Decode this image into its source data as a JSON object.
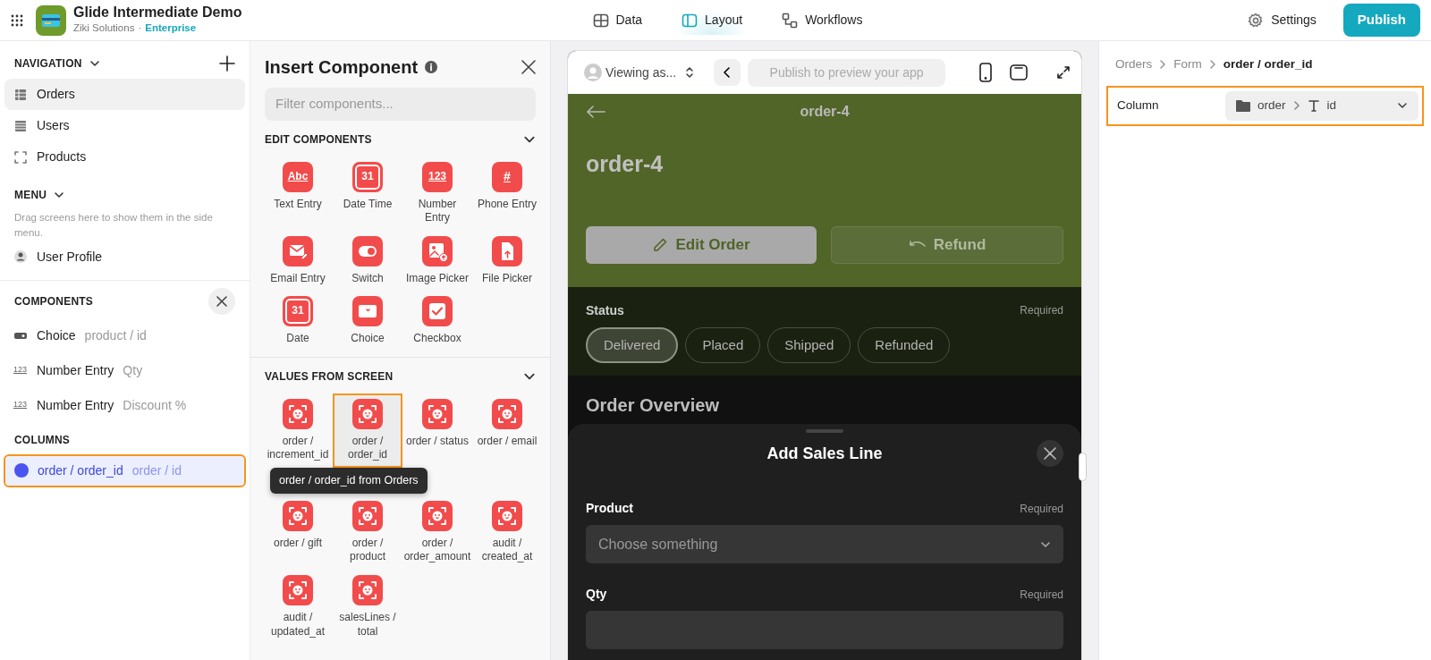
{
  "app": {
    "title": "Glide Intermediate Demo",
    "org": "Ziki Solutions",
    "separator": "·",
    "plan": "Enterprise"
  },
  "top_tabs": [
    {
      "label": "Data",
      "kind": "data",
      "selected": false
    },
    {
      "label": "Layout",
      "kind": "layout",
      "selected": true
    },
    {
      "label": "Workflows",
      "kind": "workflows",
      "selected": false
    }
  ],
  "settings_label": "Settings",
  "publish_button": "Publish",
  "sidebar": {
    "navigation_heading": "NAVIGATION",
    "nav_items": [
      {
        "label": "Orders",
        "kind": "grid",
        "selected": true
      },
      {
        "label": "Users",
        "kind": "list",
        "selected": false
      },
      {
        "label": "Products",
        "kind": "frame",
        "selected": false
      }
    ],
    "menu_heading": "MENU",
    "menu_hint": "Drag screens here to show them in the side menu.",
    "menu_items": [
      {
        "label": "User Profile",
        "kind": "person"
      }
    ],
    "components_heading": "COMPONENTS",
    "components": [
      {
        "label": "Choice",
        "detail": "product / id",
        "kind": "choice"
      },
      {
        "label": "Number Entry",
        "detail": "Qty",
        "kind": "number",
        "glyph": "123"
      },
      {
        "label": "Number Entry",
        "detail": "Discount %",
        "kind": "number",
        "glyph": "123"
      }
    ],
    "columns_heading": "COLUMNS",
    "columns": [
      {
        "label": "order / order_id",
        "detail": "order / id",
        "selected": true
      }
    ]
  },
  "insert_panel": {
    "title": "Insert Component",
    "filter_placeholder": "Filter components...",
    "sections": [
      {
        "heading": "EDIT COMPONENTS",
        "expanded": true,
        "items": [
          {
            "label": "Text Entry",
            "kind": "text",
            "glyph": "Abc",
            "selected": false
          },
          {
            "label": "Date Time",
            "kind": "datetime",
            "glyph": "31",
            "selected": false
          },
          {
            "label": "Number Entry",
            "kind": "number",
            "glyph": "123",
            "selected": false
          },
          {
            "label": "Phone Entry",
            "kind": "phone",
            "glyph": "#",
            "selected": false
          },
          {
            "label": "Email Entry",
            "kind": "email",
            "selected": false
          },
          {
            "label": "Switch",
            "kind": "switch",
            "selected": false
          },
          {
            "label": "Image Picker",
            "kind": "image",
            "selected": false
          },
          {
            "label": "File Picker",
            "kind": "file",
            "selected": false
          },
          {
            "label": "Date",
            "kind": "date",
            "glyph": "31",
            "selected": false
          },
          {
            "label": "Choice",
            "kind": "choice",
            "selected": false
          },
          {
            "label": "Checkbox",
            "kind": "checkbox",
            "selected": false
          }
        ]
      },
      {
        "heading": "VALUES FROM SCREEN",
        "expanded": true,
        "items": [
          {
            "label": "order / increment_id",
            "kind": "value",
            "selected": false
          },
          {
            "label": "order / order_id",
            "kind": "value",
            "selected": true
          },
          {
            "label": "order / status",
            "kind": "value",
            "selected": false
          },
          {
            "label": "order / email",
            "kind": "value",
            "selected": false
          },
          {
            "label": "order / gift",
            "kind": "value",
            "selected": false
          },
          {
            "label": "order / product",
            "kind": "value",
            "selected": false
          },
          {
            "label": "order / order_amount",
            "kind": "value",
            "selected": false
          },
          {
            "label": "audit / created_at",
            "kind": "value",
            "selected": false
          },
          {
            "label": "audit / updated_at",
            "kind": "value",
            "selected": false
          },
          {
            "label": "salesLines / total",
            "kind": "value",
            "selected": false
          }
        ]
      }
    ],
    "tooltip": "order / order_id from Orders"
  },
  "preview": {
    "viewing_as": "Viewing as...",
    "address_placeholder": "Publish to preview your app",
    "screen": {
      "title": "order-4",
      "heading": "order-4",
      "buttons": [
        {
          "label": "Edit Order",
          "kind": "edit"
        },
        {
          "label": "Refund",
          "kind": "undo"
        }
      ],
      "status": {
        "label": "Status",
        "required": "Required",
        "options": [
          {
            "label": "Delivered",
            "selected": true
          },
          {
            "label": "Placed",
            "selected": false
          },
          {
            "label": "Shipped",
            "selected": false
          },
          {
            "label": "Refunded",
            "selected": false
          }
        ]
      },
      "section_title": "Order Overview"
    },
    "sheet": {
      "title": "Add Sales Line",
      "fields": [
        {
          "label": "Product",
          "required": "Required",
          "kind": "select",
          "placeholder": "Choose something"
        },
        {
          "label": "Qty",
          "required": "Required",
          "kind": "input"
        }
      ]
    }
  },
  "inspector": {
    "breadcrumb": [
      "Orders",
      "Form",
      "order / order_id"
    ],
    "field_label": "Column",
    "column_path": [
      "order",
      "id"
    ],
    "highlighted": true
  }
}
